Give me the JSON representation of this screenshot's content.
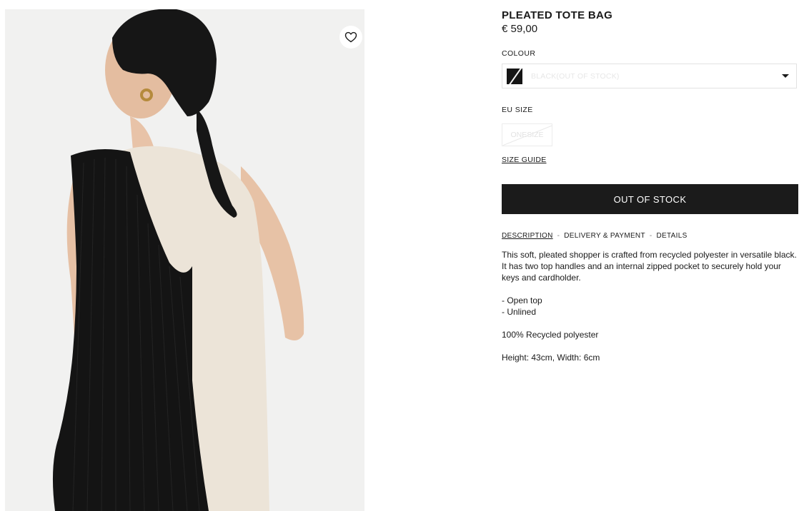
{
  "product": {
    "title": "PLEATED TOTE BAG",
    "price": "€ 59,00",
    "colour_label": "COLOUR",
    "colour_value": "BLACK(OUT OF STOCK)",
    "size_label": "EU SIZE",
    "size_value": "ONESIZE",
    "size_guide": "SIZE GUIDE",
    "cta_label": "OUT OF STOCK"
  },
  "tabs": [
    {
      "label": "DESCRIPTION"
    },
    {
      "label": "DELIVERY & PAYMENT"
    },
    {
      "label": "DETAILS"
    }
  ],
  "tab_separator": "-",
  "description": {
    "body": "This soft, pleated shopper is crafted from recycled polyester in versatile black. It has two top handles and an internal zipped pocket to securely hold your keys and cardholder.",
    "feature_1": "- Open top",
    "feature_2": "- Unlined",
    "material": "100% Recycled polyester",
    "dimensions": "Height: 43cm, Width: 6cm"
  },
  "icons": {
    "favourite": "heart-icon",
    "dropdown": "chevron-down-icon"
  },
  "colors": {
    "button_bg": "#1b1b1b",
    "photo_bg": "#f1f1f0"
  }
}
